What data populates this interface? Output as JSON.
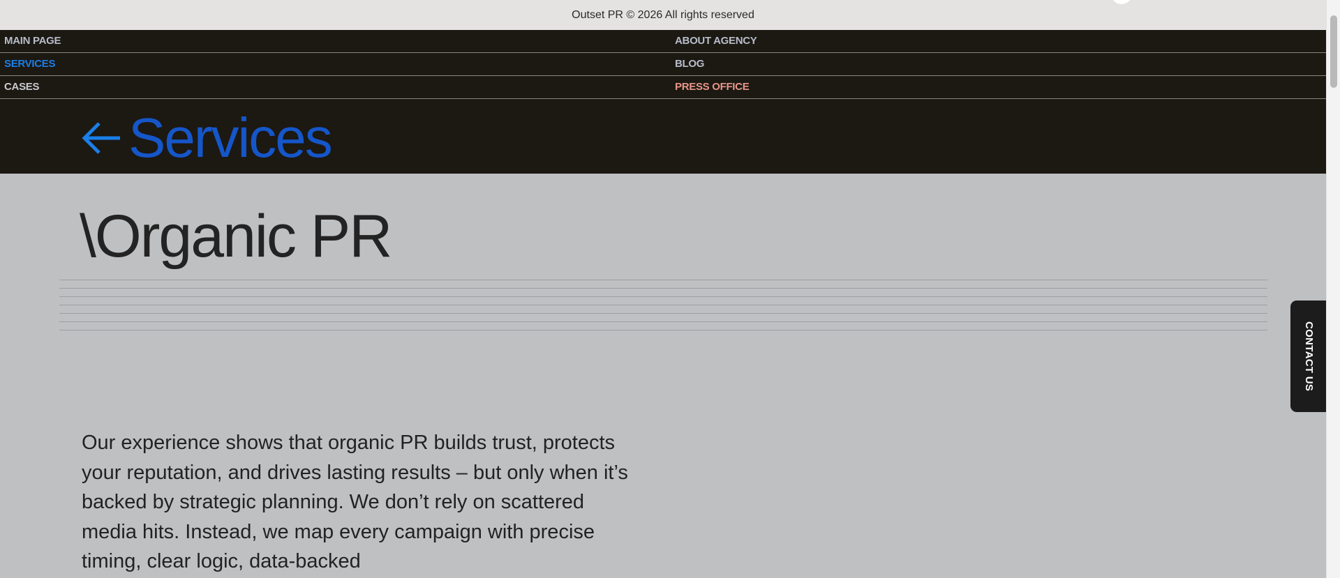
{
  "footer": {
    "copyright": "Outset PR © 2026 All rights reserved"
  },
  "nav": {
    "items": [
      {
        "label": "MAIN PAGE"
      },
      {
        "label": "ABOUT AGENCY"
      },
      {
        "label": "SERVICES"
      },
      {
        "label": "BLOG"
      },
      {
        "label": "CASES"
      },
      {
        "label": "PRESS OFFICE"
      }
    ],
    "active_color": "#1a7fe8",
    "press_color": "#e8968a"
  },
  "back": {
    "icon": "arrow-left-icon",
    "label": "Services"
  },
  "page": {
    "heading": "\\Organic PR",
    "intro": "Our experience shows that organic PR builds trust, protects your reputation, and drives lasting results – but only when it’s backed by strategic planning. We don’t rely on scattered media hits. Instead, we map every campaign with precise timing, clear logic, data-backed"
  },
  "contact": {
    "label": "CONTACT US"
  },
  "colors": {
    "nav_background": "#1c1812",
    "page_background": "#bfc0c2",
    "accent_blue": "#1556c9"
  }
}
